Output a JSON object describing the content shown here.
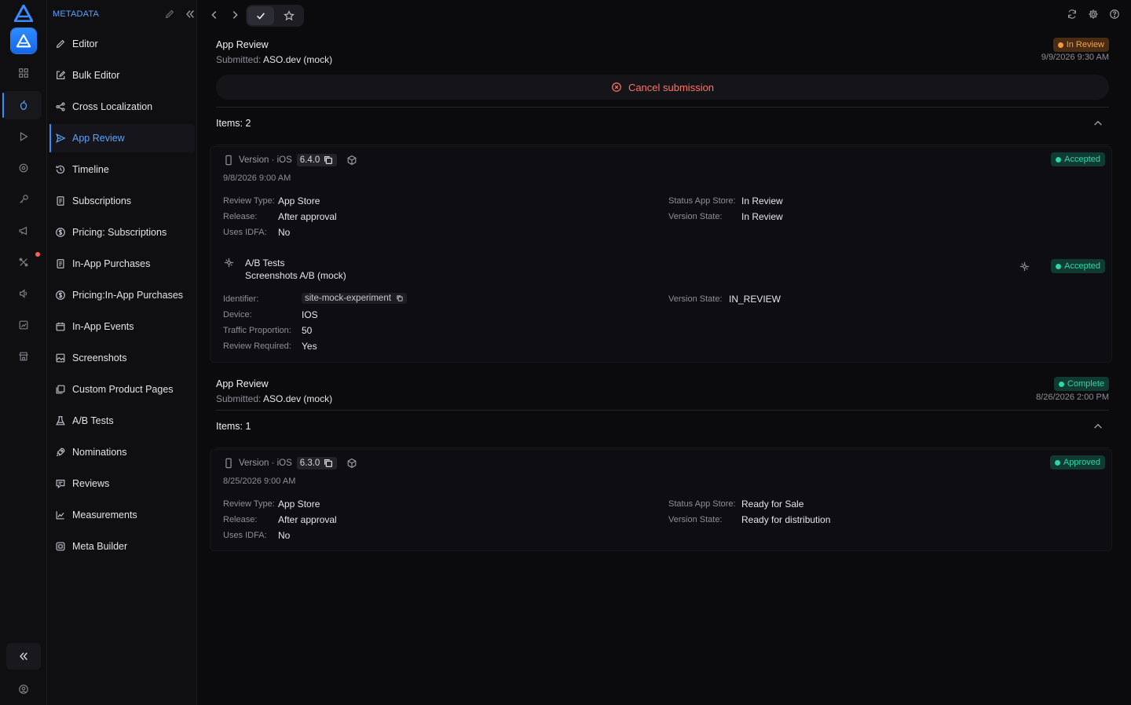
{
  "sidebar": {
    "section_title": "METADATA",
    "items": [
      {
        "label": "Editor",
        "icon": "pencil-icon"
      },
      {
        "label": "Bulk Editor",
        "icon": "edit-square-icon"
      },
      {
        "label": "Cross Localization",
        "icon": "share-nodes-icon"
      },
      {
        "label": "App Review",
        "icon": "send-icon"
      },
      {
        "label": "Timeline",
        "icon": "history-icon"
      },
      {
        "label": "Subscriptions",
        "icon": "document-icon"
      },
      {
        "label": "Pricing: Subscriptions",
        "icon": "dollar-circle-icon"
      },
      {
        "label": "In-App Purchases",
        "icon": "document-icon"
      },
      {
        "label": "Pricing:In-App Purchases",
        "icon": "dollar-circle-icon"
      },
      {
        "label": "In-App Events",
        "icon": "calendar-icon"
      },
      {
        "label": "Screenshots",
        "icon": "image-icon"
      },
      {
        "label": "Custom Product Pages",
        "icon": "pages-icon"
      },
      {
        "label": "A/B Tests",
        "icon": "flask-icon"
      },
      {
        "label": "Nominations",
        "icon": "rocket-icon"
      },
      {
        "label": "Reviews",
        "icon": "message-icon"
      },
      {
        "label": "Measurements",
        "icon": "chart-icon"
      },
      {
        "label": "Meta Builder",
        "icon": "box-icon"
      }
    ],
    "active_index": 3
  },
  "submissions": [
    {
      "title": "App Review",
      "submitted_label": "Submitted:",
      "submitted_by": "ASO.dev (mock)",
      "status": "In Review",
      "timestamp": "9/9/2026 9:30 AM",
      "cancel_label": "Cancel submission",
      "items_label": "Items: 2",
      "items": [
        {
          "kind": "version",
          "version_label": "Version · iOS",
          "version": "6.4.0",
          "date": "9/8/2026 9:00 AM",
          "status": "Accepted",
          "left": [
            {
              "label": "Review Type:",
              "value": "App Store"
            },
            {
              "label": "Release:",
              "value": "After approval"
            },
            {
              "label": "Uses IDFA:",
              "value": "No"
            }
          ],
          "right": [
            {
              "label": "Status App Store:",
              "value": "In Review"
            },
            {
              "label": "Version State:",
              "value": "In Review"
            }
          ]
        },
        {
          "kind": "ab_test",
          "heading": "A/B Tests",
          "name": "Screenshots A/B (mock)",
          "status": "Accepted",
          "left": [
            {
              "label": "Identifier:",
              "value": "site-mock-experiment"
            },
            {
              "label": "Device:",
              "value": "IOS"
            },
            {
              "label": "Traffic Proportion:",
              "value": "50"
            },
            {
              "label": "Review Required:",
              "value": "Yes"
            }
          ],
          "right": [
            {
              "label": "Version State:",
              "value": "IN_REVIEW"
            }
          ]
        }
      ]
    },
    {
      "title": "App Review",
      "submitted_label": "Submitted:",
      "submitted_by": "ASO.dev (mock)",
      "status": "Complete",
      "timestamp": "8/26/2026 2:00 PM",
      "items_label": "Items: 1",
      "items": [
        {
          "kind": "version",
          "version_label": "Version · iOS",
          "version": "6.3.0",
          "date": "8/25/2026 9:00 AM",
          "status": "Approved",
          "left": [
            {
              "label": "Review Type:",
              "value": "App Store"
            },
            {
              "label": "Release:",
              "value": "After approval"
            },
            {
              "label": "Uses IDFA:",
              "value": "No"
            }
          ],
          "right": [
            {
              "label": "Status App Store:",
              "value": "Ready for Sale"
            },
            {
              "label": "Version State:",
              "value": "Ready for distribution"
            }
          ]
        }
      ]
    }
  ],
  "colors": {
    "accent": "#3b8bff",
    "in_review": "#f39b3a",
    "accepted": "#33d4a6",
    "cancel": "#ff7366",
    "background": "#0b0b0d"
  }
}
